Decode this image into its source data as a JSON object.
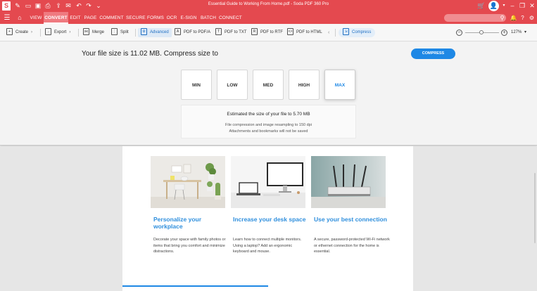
{
  "titlebar": {
    "title": "Essential Guide to Working From Home.pdf - Soda PDF 360 Pro",
    "logo": "S"
  },
  "menu": {
    "tabs": [
      {
        "label": "VIEW"
      },
      {
        "label": "CONVERT"
      },
      {
        "label": "EDIT"
      },
      {
        "label": "PAGE"
      },
      {
        "label": "COMMENT"
      },
      {
        "label": "SECURE"
      },
      {
        "label": "FORMS"
      },
      {
        "label": "OCR"
      },
      {
        "label": "E-SIGN"
      },
      {
        "label": "BATCH"
      },
      {
        "label": "CONNECT"
      }
    ],
    "active_tab": "CONVERT",
    "search_placeholder": ""
  },
  "toolbar": {
    "create": "Create",
    "export": "Export",
    "merge": "Merge",
    "split": "Split",
    "advanced": "Advanced",
    "pdf_to_pdfa": "PDF to PDF/A",
    "pdf_to_txt": "PDF to TXT",
    "pdf_to_rtf": "PDF to RTF",
    "pdf_to_html": "PDF to HTML",
    "compress": "Compress",
    "zoom": "127%",
    "zoom_level": 0.48
  },
  "compress_panel": {
    "file_size_text": "Your file size is 11.02 MB. Compress size to",
    "button_label": "COMPRESS",
    "levels": [
      "MIN",
      "LOW",
      "MED",
      "HIGH",
      "MAX"
    ],
    "selected_level": "MAX",
    "estimate_title": "Estimated the size of your file to 5.70 MB",
    "estimate_line1": "File compression and image resampling to 150 dpi",
    "estimate_line2": "Attachments and bookmarks will not be saved"
  },
  "document": {
    "cards": [
      {
        "title": "Personalize your workplace",
        "text": "Decorate your space with family photos or items that bring you comfort and minimize distractions."
      },
      {
        "title": "Increase your desk space",
        "text": "Learn how to connect multiple monitors. Using a laptop? Add an ergonomic keyboard and mouse."
      },
      {
        "title": "Use your best connection",
        "text": "A secure, password-protected Wi-Fi network or ethernet connection for the home is essential."
      }
    ],
    "progress": 0.5
  },
  "colors": {
    "brand_red": "#e4494f",
    "accent_blue": "#1e88e5",
    "card_title_blue": "#2f8fdd"
  }
}
